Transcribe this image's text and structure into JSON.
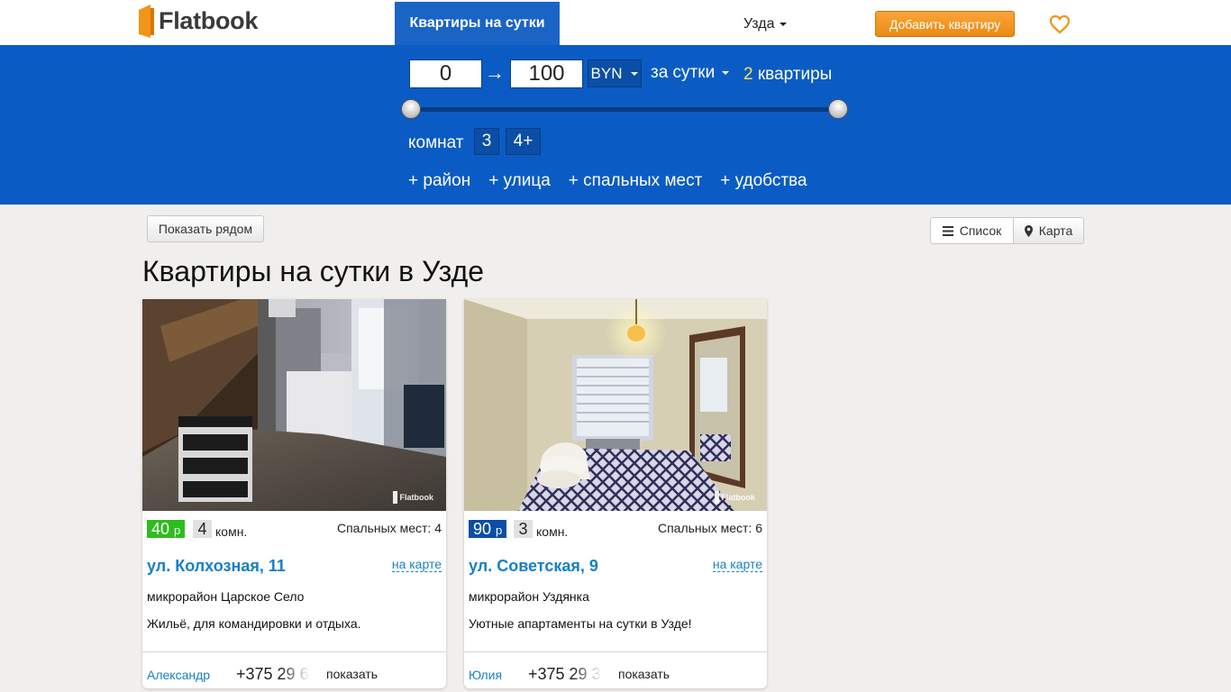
{
  "header": {
    "logo_text": "Flatbook",
    "nav_active": "Квартиры на сутки",
    "city": "Узда",
    "add_button": "Добавить квартиру",
    "favorites_icon": "heart-icon"
  },
  "filters": {
    "price_min": "0",
    "arrow": "→",
    "price_max": "100",
    "currency": "BYN",
    "period": "за сутки",
    "count_number": "2",
    "count_label": "квартиры",
    "price_range_fraction": [
      0,
      1
    ],
    "rooms_label": "комнат",
    "room_options": [
      "3",
      "4+"
    ],
    "links": [
      "+ район",
      "+ улица",
      "+ спальных мест",
      "+ удобства"
    ]
  },
  "toolbar": {
    "nearby_button": "Показать рядом",
    "list_button": "Список",
    "map_button": "Карта"
  },
  "page_title": "Квартиры на сутки в Узде",
  "listings": [
    {
      "price": "40",
      "price_unit": "р",
      "price_color": "#2ebd1c",
      "rooms": "4",
      "rooms_label": "комн.",
      "beds": "Спальных мест: 4",
      "street": "ул. Колхозная, 11",
      "map_link": "на карте",
      "district": "микрорайон Царское Село",
      "description": "Жильё, для командировки и отдыха.",
      "owner": "Александр",
      "phone": "+375 29 6",
      "show_label": "показать",
      "watermark": "Flatbook"
    },
    {
      "price": "90",
      "price_unit": "р",
      "price_color": "#0b4ea6",
      "rooms": "3",
      "rooms_label": "комн.",
      "beds": "Спальных мест: 6",
      "street": "ул. Советская, 9",
      "map_link": "на карте",
      "district": "микрорайон Уздянка",
      "description": "Уютные апартаменты на сутки в Узде!",
      "owner": "Юлия",
      "phone": "+375 29 3",
      "show_label": "показать",
      "watermark": "Flatbook"
    }
  ],
  "colors": {
    "brand_blue": "#0a5cc4",
    "accent_orange": "#f29419",
    "link_blue": "#1780c5"
  }
}
